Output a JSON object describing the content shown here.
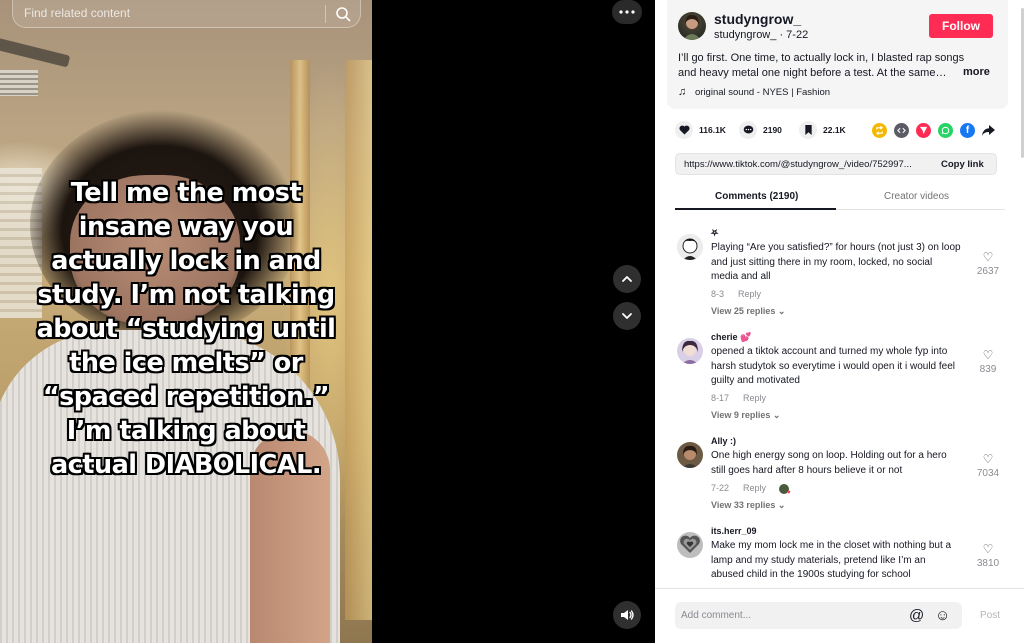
{
  "search": {
    "placeholder": "Find related content",
    "icon": "search-icon"
  },
  "video": {
    "overlay_text": "Tell me the most\ninsane way you\nactually lock in and\nstudy. I’m not talking\nabout “studying until\nthe ice melts” or\n“spaced repetition.”\nI’m talking about\nactual DIABOLICAL."
  },
  "post": {
    "username": "studyngrow_",
    "handle": "studyngrow_",
    "date": "7-22",
    "follow_label": "Follow",
    "description": "I’ll go first. One time, to actually lock in, I blasted rap songs and heavy metal one night before a test. At the same…",
    "more_label": "more",
    "sound": "original sound - NYES | Fashion"
  },
  "stats": {
    "likes": "116.1K",
    "comments": "2190",
    "saves": "22.1K"
  },
  "share_colors": {
    "repost": "#f5b800",
    "embed": "#5c5c66",
    "send": "#fe2c55",
    "whatsapp": "#25d366",
    "facebook": "#1877f2"
  },
  "link": {
    "url": "https://www.tiktok.com/@studyngrow_/video/752997...",
    "copy_label": "Copy link"
  },
  "tabs": {
    "comments": "Comments (2190)",
    "creator": "Creator videos"
  },
  "comments": [
    {
      "user": "⛧",
      "text": "Playing “Are you satisfied?” for hours (not just 3) on loop and just sitting there in my room, locked, no social media and all",
      "date": "8-3",
      "reply": "Reply",
      "views": "View 25 replies",
      "likes": "2637"
    },
    {
      "user": "cherie 💕",
      "text": "opened a tiktok account and turned my whole fyp into harsh studytok so everytime i would open it i would feel guilty and motivated",
      "date": "8-17",
      "reply": "Reply",
      "views": "View 9 replies",
      "likes": "839"
    },
    {
      "user": "Ally :)",
      "text": "One high energy song on loop. Holding out for a hero still goes hard after 8 hours believe it or not",
      "date": "7-22",
      "reply": "Reply",
      "views": "View 33 replies",
      "likes": "7034"
    },
    {
      "user": "its.herr_09",
      "text": "Make my mom lock me in the closet with nothing but a lamp and my study materials, pretend like I’m an abused child in the 1900s studying for school",
      "likes": "3810"
    }
  ],
  "comment_box": {
    "placeholder": "Add comment...",
    "post_label": "Post"
  }
}
